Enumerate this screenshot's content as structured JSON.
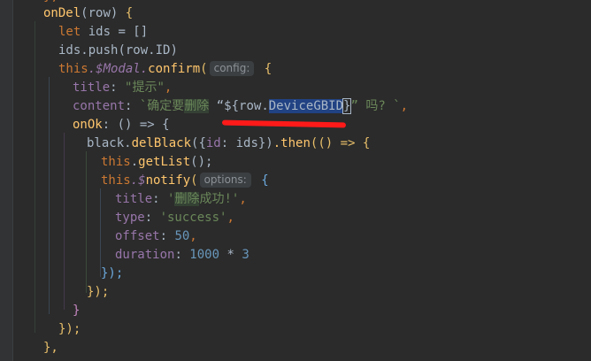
{
  "editor": {
    "top_fragment": "},",
    "lines": {
      "l1": {
        "name": "onDel",
        "open": "(",
        "param": "row",
        "close": ")",
        "brace": " {"
      },
      "l2": {
        "kw": "let",
        "rest": " ids = []"
      },
      "l3": {
        "obj": "ids",
        "method": ".push(",
        "arg": "row.ID",
        "close": ")"
      },
      "l4": {
        "kw": "this",
        "rest": ".$Modal.",
        "method": "confirm",
        "open": "(",
        "hint": "config:",
        "brace": " {"
      },
      "l5": {
        "key": "title",
        "colon": ": ",
        "value": "\"提示\"",
        "comma": ","
      },
      "l6": {
        "key": "content",
        "colon": ": ",
        "t1": "`确定要",
        "t2": "删除",
        "t3": " “${",
        "t4": "row.",
        "t5": "DeviceGBID",
        "t6": "}",
        "t7": "” 吗? `",
        "comma": ","
      },
      "l7": {
        "key": "onOk",
        "rest": ": () => {"
      },
      "l8": {
        "obj": "black.",
        "method": "delBlack",
        "open": "({",
        "key": "id",
        "rest": ": ids})",
        "then": ".then",
        "arrow": "(() => {"
      },
      "l9": {
        "kw": "this",
        "dot": ".",
        "method": "getList",
        "rest": "();"
      },
      "l10": {
        "kw": "this",
        "rest": ".$",
        "method": "notify",
        "open": "(",
        "hint": "options:",
        "brace": " {"
      },
      "l11": {
        "key": "title",
        "colon": ": ",
        "q1": "'",
        "w1": "删除",
        "w2": "成功!",
        "q2": "'",
        "comma": ","
      },
      "l12": {
        "key": "type",
        "colon": ": ",
        "value": "'success'",
        "comma": ","
      },
      "l13": {
        "key": "offset",
        "colon": ": ",
        "value": "50",
        "comma": ","
      },
      "l14": {
        "key": "duration",
        "colon": ": ",
        "value": "1000",
        "op": " * ",
        "value2": "3"
      },
      "l15": {
        "text": "});"
      },
      "l16": {
        "text": "});"
      },
      "l17": {
        "text": "}"
      },
      "l18": {
        "text": "});"
      },
      "l19": {
        "text": "},"
      }
    }
  },
  "colors": {
    "background": "#2b2b2b",
    "keyword": "#cc7832",
    "function": "#ffc66d",
    "string": "#6a8759",
    "number": "#6897bb",
    "property": "#9876aa",
    "annotation_underline": "#ff1a1a"
  }
}
